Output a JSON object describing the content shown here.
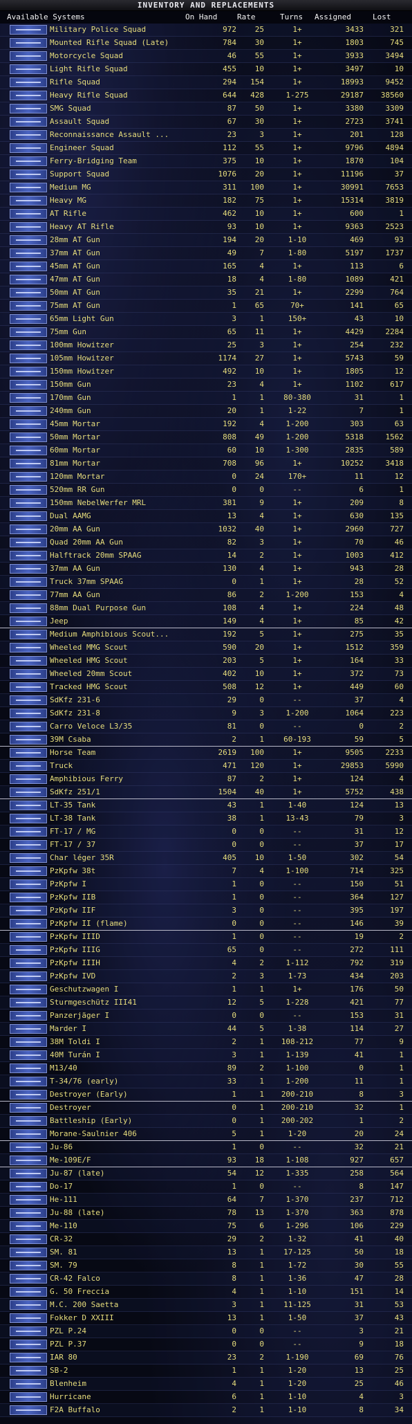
{
  "window": {
    "title": "INVENTORY AND REPLACEMENTS"
  },
  "columns": {
    "systems": "Available Systems",
    "on_hand": "On Hand",
    "rate": "Rate",
    "turns": "Turns",
    "assigned": "Assigned",
    "lost": "Lost"
  },
  "rows": [
    {
      "name": "Military Police Squad",
      "on_hand": "972",
      "rate": "25",
      "turns": "1+",
      "assigned": "3433",
      "lost": "321"
    },
    {
      "name": "Mounted Rifle Squad (Late)",
      "on_hand": "784",
      "rate": "30",
      "turns": "1+",
      "assigned": "1803",
      "lost": "745"
    },
    {
      "name": "Motorcycle Squad",
      "on_hand": "46",
      "rate": "55",
      "turns": "1+",
      "assigned": "3933",
      "lost": "3494"
    },
    {
      "name": "Light Rifle Squad",
      "on_hand": "455",
      "rate": "10",
      "turns": "1+",
      "assigned": "3497",
      "lost": "10"
    },
    {
      "name": "Rifle Squad",
      "on_hand": "294",
      "rate": "154",
      "turns": "1+",
      "assigned": "18993",
      "lost": "9452"
    },
    {
      "name": "Heavy Rifle Squad",
      "on_hand": "644",
      "rate": "428",
      "turns": "1-275",
      "assigned": "29187",
      "lost": "38560"
    },
    {
      "name": "SMG Squad",
      "on_hand": "87",
      "rate": "50",
      "turns": "1+",
      "assigned": "3380",
      "lost": "3309"
    },
    {
      "name": "Assault Squad",
      "on_hand": "67",
      "rate": "30",
      "turns": "1+",
      "assigned": "2723",
      "lost": "3741"
    },
    {
      "name": "Reconnaissance Assault ...",
      "on_hand": "23",
      "rate": "3",
      "turns": "1+",
      "assigned": "201",
      "lost": "128"
    },
    {
      "name": "Engineer Squad",
      "on_hand": "112",
      "rate": "55",
      "turns": "1+",
      "assigned": "9796",
      "lost": "4894"
    },
    {
      "name": "Ferry-Bridging Team",
      "on_hand": "375",
      "rate": "10",
      "turns": "1+",
      "assigned": "1870",
      "lost": "104"
    },
    {
      "name": "Support Squad",
      "on_hand": "1076",
      "rate": "20",
      "turns": "1+",
      "assigned": "11196",
      "lost": "37"
    },
    {
      "name": "Medium MG",
      "on_hand": "311",
      "rate": "100",
      "turns": "1+",
      "assigned": "30991",
      "lost": "7653"
    },
    {
      "name": "Heavy MG",
      "on_hand": "182",
      "rate": "75",
      "turns": "1+",
      "assigned": "15314",
      "lost": "3819"
    },
    {
      "name": "AT Rifle",
      "on_hand": "462",
      "rate": "10",
      "turns": "1+",
      "assigned": "600",
      "lost": "1"
    },
    {
      "name": "Heavy AT Rifle",
      "on_hand": "93",
      "rate": "10",
      "turns": "1+",
      "assigned": "9363",
      "lost": "2523"
    },
    {
      "name": "28mm AT Gun",
      "on_hand": "194",
      "rate": "20",
      "turns": "1-10",
      "assigned": "469",
      "lost": "93"
    },
    {
      "name": "37mm AT Gun",
      "on_hand": "49",
      "rate": "7",
      "turns": "1-80",
      "assigned": "5197",
      "lost": "1737"
    },
    {
      "name": "45mm AT Gun",
      "on_hand": "165",
      "rate": "4",
      "turns": "1+",
      "assigned": "113",
      "lost": "6"
    },
    {
      "name": "47mm AT Gun",
      "on_hand": "18",
      "rate": "4",
      "turns": "1-80",
      "assigned": "1089",
      "lost": "421"
    },
    {
      "name": "50mm AT Gun",
      "on_hand": "35",
      "rate": "21",
      "turns": "1+",
      "assigned": "2299",
      "lost": "764"
    },
    {
      "name": "75mm AT Gun",
      "on_hand": "1",
      "rate": "65",
      "turns": "70+",
      "assigned": "141",
      "lost": "65"
    },
    {
      "name": "65mm Light Gun",
      "on_hand": "3",
      "rate": "1",
      "turns": "150+",
      "assigned": "43",
      "lost": "10"
    },
    {
      "name": "75mm Gun",
      "on_hand": "65",
      "rate": "11",
      "turns": "1+",
      "assigned": "4429",
      "lost": "2284"
    },
    {
      "name": "100mm Howitzer",
      "on_hand": "25",
      "rate": "3",
      "turns": "1+",
      "assigned": "254",
      "lost": "232"
    },
    {
      "name": "105mm Howitzer",
      "on_hand": "1174",
      "rate": "27",
      "turns": "1+",
      "assigned": "5743",
      "lost": "59"
    },
    {
      "name": "150mm Howitzer",
      "on_hand": "492",
      "rate": "10",
      "turns": "1+",
      "assigned": "1805",
      "lost": "12"
    },
    {
      "name": "150mm Gun",
      "on_hand": "23",
      "rate": "4",
      "turns": "1+",
      "assigned": "1102",
      "lost": "617"
    },
    {
      "name": "170mm Gun",
      "on_hand": "1",
      "rate": "1",
      "turns": "80-380",
      "assigned": "31",
      "lost": "1"
    },
    {
      "name": "240mm Gun",
      "on_hand": "20",
      "rate": "1",
      "turns": "1-22",
      "assigned": "7",
      "lost": "1"
    },
    {
      "name": "45mm Mortar",
      "on_hand": "192",
      "rate": "4",
      "turns": "1-200",
      "assigned": "303",
      "lost": "63"
    },
    {
      "name": "50mm Mortar",
      "on_hand": "808",
      "rate": "49",
      "turns": "1-200",
      "assigned": "5318",
      "lost": "1562"
    },
    {
      "name": "60mm Mortar",
      "on_hand": "60",
      "rate": "10",
      "turns": "1-300",
      "assigned": "2835",
      "lost": "589"
    },
    {
      "name": "81mm Mortar",
      "on_hand": "708",
      "rate": "96",
      "turns": "1+",
      "assigned": "10252",
      "lost": "3418"
    },
    {
      "name": "120mm Mortar",
      "on_hand": "0",
      "rate": "24",
      "turns": "170+",
      "assigned": "11",
      "lost": "12"
    },
    {
      "name": "520mm RR Gun",
      "on_hand": "0",
      "rate": "0",
      "turns": "--",
      "assigned": "6",
      "lost": "1"
    },
    {
      "name": "150mm NebelWerfer MRL",
      "on_hand": "381",
      "rate": "9",
      "turns": "1+",
      "assigned": "209",
      "lost": "8"
    },
    {
      "name": "Dual AAMG",
      "on_hand": "13",
      "rate": "4",
      "turns": "1+",
      "assigned": "630",
      "lost": "135"
    },
    {
      "name": "20mm AA Gun",
      "on_hand": "1032",
      "rate": "40",
      "turns": "1+",
      "assigned": "2960",
      "lost": "727"
    },
    {
      "name": "Quad 20mm AA Gun",
      "on_hand": "82",
      "rate": "3",
      "turns": "1+",
      "assigned": "70",
      "lost": "46"
    },
    {
      "name": "Halftrack 20mm SPAAG",
      "on_hand": "14",
      "rate": "2",
      "turns": "1+",
      "assigned": "1003",
      "lost": "412"
    },
    {
      "name": "37mm AA Gun",
      "on_hand": "130",
      "rate": "4",
      "turns": "1+",
      "assigned": "943",
      "lost": "28"
    },
    {
      "name": "Truck 37mm SPAAG",
      "on_hand": "0",
      "rate": "1",
      "turns": "1+",
      "assigned": "28",
      "lost": "52"
    },
    {
      "name": "77mm AA Gun",
      "on_hand": "86",
      "rate": "2",
      "turns": "1-200",
      "assigned": "153",
      "lost": "4"
    },
    {
      "name": "88mm Dual Purpose Gun",
      "on_hand": "108",
      "rate": "4",
      "turns": "1+",
      "assigned": "224",
      "lost": "48"
    },
    {
      "name": "Jeep",
      "on_hand": "149",
      "rate": "4",
      "turns": "1+",
      "assigned": "85",
      "lost": "42"
    },
    {
      "name": "Medium Amphibious Scout...",
      "on_hand": "192",
      "rate": "5",
      "turns": "1+",
      "assigned": "275",
      "lost": "35"
    },
    {
      "name": "Wheeled MMG Scout",
      "on_hand": "590",
      "rate": "20",
      "turns": "1+",
      "assigned": "1512",
      "lost": "359"
    },
    {
      "name": "Wheeled HMG Scout",
      "on_hand": "203",
      "rate": "5",
      "turns": "1+",
      "assigned": "164",
      "lost": "33"
    },
    {
      "name": "Wheeled 20mm Scout",
      "on_hand": "402",
      "rate": "10",
      "turns": "1+",
      "assigned": "372",
      "lost": "73"
    },
    {
      "name": "Tracked HMG Scout",
      "on_hand": "508",
      "rate": "12",
      "turns": "1+",
      "assigned": "449",
      "lost": "60"
    },
    {
      "name": "SdKfz 231-6",
      "on_hand": "29",
      "rate": "0",
      "turns": "--",
      "assigned": "37",
      "lost": "4"
    },
    {
      "name": "SdKfz 231-8",
      "on_hand": "9",
      "rate": "3",
      "turns": "1-200",
      "assigned": "1064",
      "lost": "223"
    },
    {
      "name": "Carro Veloce L3/35",
      "on_hand": "81",
      "rate": "0",
      "turns": "--",
      "assigned": "0",
      "lost": "2"
    },
    {
      "name": "39M Csaba",
      "on_hand": "2",
      "rate": "1",
      "turns": "60-193",
      "assigned": "59",
      "lost": "5"
    },
    {
      "name": "Horse Team",
      "on_hand": "2619",
      "rate": "100",
      "turns": "1+",
      "assigned": "9505",
      "lost": "2233"
    },
    {
      "name": "Truck",
      "on_hand": "471",
      "rate": "120",
      "turns": "1+",
      "assigned": "29853",
      "lost": "5990"
    },
    {
      "name": "Amphibious Ferry",
      "on_hand": "87",
      "rate": "2",
      "turns": "1+",
      "assigned": "124",
      "lost": "4"
    },
    {
      "name": "SdKfz 251/1",
      "on_hand": "1504",
      "rate": "40",
      "turns": "1+",
      "assigned": "5752",
      "lost": "438"
    },
    {
      "name": "LT-35 Tank",
      "on_hand": "43",
      "rate": "1",
      "turns": "1-40",
      "assigned": "124",
      "lost": "13"
    },
    {
      "name": "LT-38 Tank",
      "on_hand": "38",
      "rate": "1",
      "turns": "13-43",
      "assigned": "79",
      "lost": "3"
    },
    {
      "name": "FT-17 / MG",
      "on_hand": "0",
      "rate": "0",
      "turns": "--",
      "assigned": "31",
      "lost": "12"
    },
    {
      "name": "FT-17 / 37",
      "on_hand": "0",
      "rate": "0",
      "turns": "--",
      "assigned": "37",
      "lost": "17"
    },
    {
      "name": "Char léger 35R",
      "on_hand": "405",
      "rate": "10",
      "turns": "1-50",
      "assigned": "302",
      "lost": "54"
    },
    {
      "name": "PzKpfw 38t",
      "on_hand": "7",
      "rate": "4",
      "turns": "1-100",
      "assigned": "714",
      "lost": "325"
    },
    {
      "name": "PzKpfw I",
      "on_hand": "1",
      "rate": "0",
      "turns": "--",
      "assigned": "150",
      "lost": "51"
    },
    {
      "name": "PzKpfw IIB",
      "on_hand": "1",
      "rate": "0",
      "turns": "--",
      "assigned": "364",
      "lost": "127"
    },
    {
      "name": "PzKpfw IIF",
      "on_hand": "3",
      "rate": "0",
      "turns": "--",
      "assigned": "395",
      "lost": "197"
    },
    {
      "name": "PzKpfw II (flame)",
      "on_hand": "0",
      "rate": "0",
      "turns": "--",
      "assigned": "146",
      "lost": "39"
    },
    {
      "name": "PzKpfw IIID",
      "on_hand": "1",
      "rate": "0",
      "turns": "--",
      "assigned": "19",
      "lost": "2"
    },
    {
      "name": "PzKpfw IIIG",
      "on_hand": "65",
      "rate": "0",
      "turns": "--",
      "assigned": "272",
      "lost": "111"
    },
    {
      "name": "PzKpfw IIIH",
      "on_hand": "4",
      "rate": "2",
      "turns": "1-112",
      "assigned": "792",
      "lost": "319"
    },
    {
      "name": "PzKpfw IVD",
      "on_hand": "2",
      "rate": "3",
      "turns": "1-73",
      "assigned": "434",
      "lost": "203"
    },
    {
      "name": "Geschutzwagen I",
      "on_hand": "1",
      "rate": "1",
      "turns": "1+",
      "assigned": "176",
      "lost": "50"
    },
    {
      "name": "Sturmgeschütz III41",
      "on_hand": "12",
      "rate": "5",
      "turns": "1-228",
      "assigned": "421",
      "lost": "77"
    },
    {
      "name": "Panzerjäger I",
      "on_hand": "0",
      "rate": "0",
      "turns": "--",
      "assigned": "153",
      "lost": "31"
    },
    {
      "name": "Marder I",
      "on_hand": "44",
      "rate": "5",
      "turns": "1-38",
      "assigned": "114",
      "lost": "27"
    },
    {
      "name": "38M Toldi I",
      "on_hand": "2",
      "rate": "1",
      "turns": "108-212",
      "assigned": "77",
      "lost": "9"
    },
    {
      "name": "40M Turán I",
      "on_hand": "3",
      "rate": "1",
      "turns": "1-139",
      "assigned": "41",
      "lost": "1"
    },
    {
      "name": "M13/40",
      "on_hand": "89",
      "rate": "2",
      "turns": "1-100",
      "assigned": "0",
      "lost": "1"
    },
    {
      "name": "T-34/76 (early)",
      "on_hand": "33",
      "rate": "1",
      "turns": "1-200",
      "assigned": "11",
      "lost": "1"
    },
    {
      "name": "Destroyer (Early)",
      "on_hand": "1",
      "rate": "1",
      "turns": "200-210",
      "assigned": "8",
      "lost": "3"
    },
    {
      "name": "Destroyer",
      "on_hand": "0",
      "rate": "1",
      "turns": "200-210",
      "assigned": "32",
      "lost": "1"
    },
    {
      "name": "Battleship (Early)",
      "on_hand": "0",
      "rate": "1",
      "turns": "200-202",
      "assigned": "1",
      "lost": "2"
    },
    {
      "name": "Morane-Saulnier 406",
      "on_hand": "5",
      "rate": "1",
      "turns": "1-20",
      "assigned": "20",
      "lost": "24"
    },
    {
      "name": "Ju-86",
      "on_hand": "1",
      "rate": "0",
      "turns": "--",
      "assigned": "32",
      "lost": "21"
    },
    {
      "name": "Me-109E/F",
      "on_hand": "93",
      "rate": "18",
      "turns": "1-108",
      "assigned": "927",
      "lost": "657"
    },
    {
      "name": "Ju-87 (late)",
      "on_hand": "54",
      "rate": "12",
      "turns": "1-335",
      "assigned": "258",
      "lost": "564"
    },
    {
      "name": "Do-17",
      "on_hand": "1",
      "rate": "0",
      "turns": "--",
      "assigned": "8",
      "lost": "147"
    },
    {
      "name": "He-111",
      "on_hand": "64",
      "rate": "7",
      "turns": "1-370",
      "assigned": "237",
      "lost": "712"
    },
    {
      "name": "Ju-88 (late)",
      "on_hand": "78",
      "rate": "13",
      "turns": "1-370",
      "assigned": "363",
      "lost": "878"
    },
    {
      "name": "Me-110",
      "on_hand": "75",
      "rate": "6",
      "turns": "1-296",
      "assigned": "106",
      "lost": "229"
    },
    {
      "name": "CR-32",
      "on_hand": "29",
      "rate": "2",
      "turns": "1-32",
      "assigned": "41",
      "lost": "40"
    },
    {
      "name": "SM. 81",
      "on_hand": "13",
      "rate": "1",
      "turns": "17-125",
      "assigned": "50",
      "lost": "18"
    },
    {
      "name": "SM. 79",
      "on_hand": "8",
      "rate": "1",
      "turns": "1-72",
      "assigned": "30",
      "lost": "55"
    },
    {
      "name": "CR-42 Falco",
      "on_hand": "8",
      "rate": "1",
      "turns": "1-36",
      "assigned": "47",
      "lost": "28"
    },
    {
      "name": "G. 50 Freccia",
      "on_hand": "4",
      "rate": "1",
      "turns": "1-10",
      "assigned": "151",
      "lost": "14"
    },
    {
      "name": "M.C. 200 Saetta",
      "on_hand": "3",
      "rate": "1",
      "turns": "11-125",
      "assigned": "31",
      "lost": "53"
    },
    {
      "name": "Fokker D XXIII",
      "on_hand": "13",
      "rate": "1",
      "turns": "1-50",
      "assigned": "37",
      "lost": "43"
    },
    {
      "name": "PZL P.24",
      "on_hand": "0",
      "rate": "0",
      "turns": "--",
      "assigned": "3",
      "lost": "21"
    },
    {
      "name": "PZL P.37",
      "on_hand": "0",
      "rate": "0",
      "turns": "--",
      "assigned": "9",
      "lost": "18"
    },
    {
      "name": "IAR 80",
      "on_hand": "23",
      "rate": "2",
      "turns": "1-190",
      "assigned": "69",
      "lost": "76"
    },
    {
      "name": "SB-2",
      "on_hand": "1",
      "rate": "1",
      "turns": "1-20",
      "assigned": "13",
      "lost": "25"
    },
    {
      "name": "Blenheim",
      "on_hand": "4",
      "rate": "1",
      "turns": "1-20",
      "assigned": "25",
      "lost": "46"
    },
    {
      "name": "Hurricane",
      "on_hand": "6",
      "rate": "1",
      "turns": "1-10",
      "assigned": "4",
      "lost": "3"
    },
    {
      "name": "F2A Buffalo",
      "on_hand": "2",
      "rate": "1",
      "turns": "1-10",
      "assigned": "8",
      "lost": "34"
    }
  ],
  "colors": {
    "text": "#e7dd7c",
    "header_text": "#f2f2f2",
    "background": "#05060e"
  }
}
